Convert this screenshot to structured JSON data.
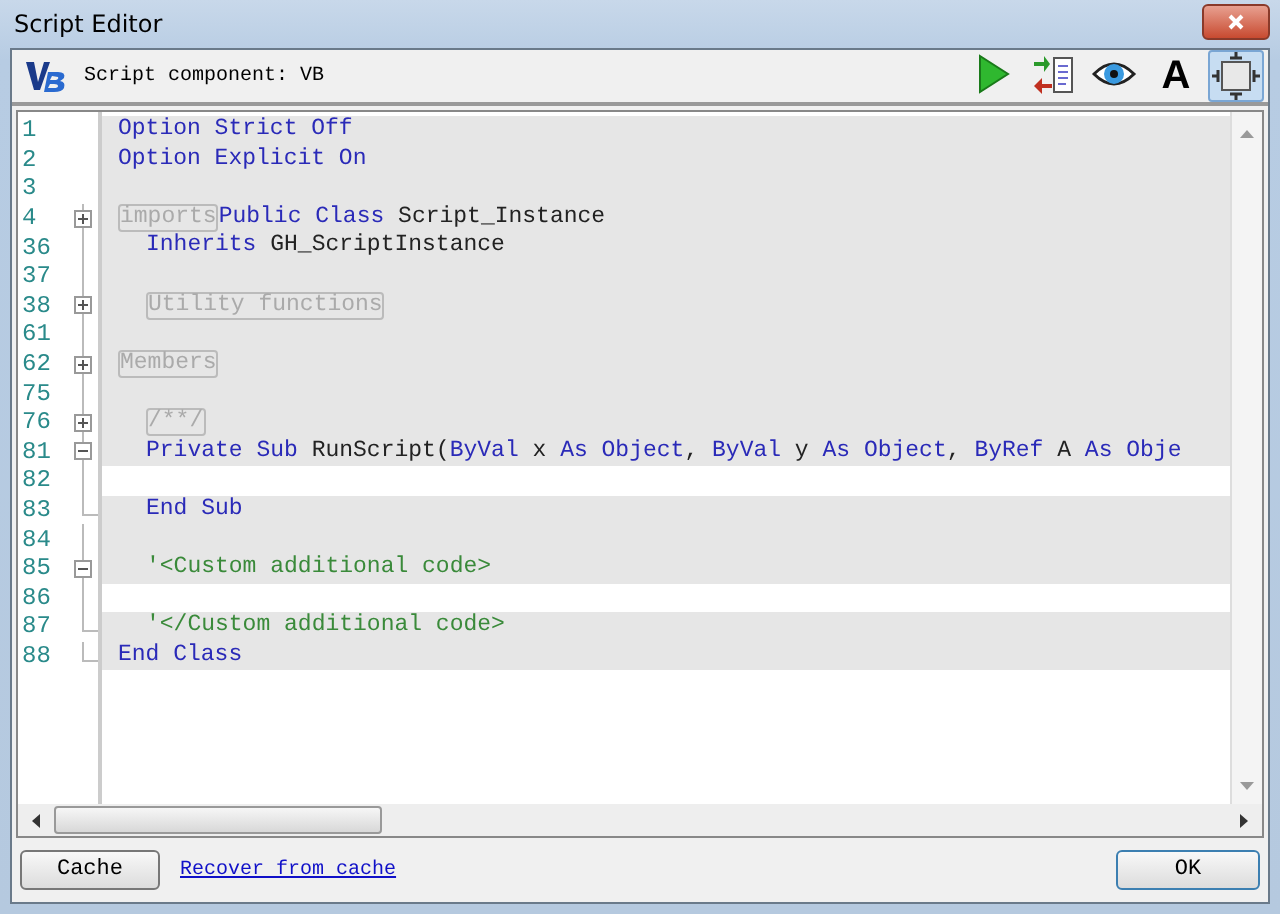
{
  "window": {
    "title": "Script Editor"
  },
  "toolbar": {
    "component_label": "Script component: VB",
    "buttons": [
      {
        "kind": "run",
        "selected": false
      },
      {
        "kind": "transfer",
        "selected": false
      },
      {
        "kind": "eye",
        "selected": false
      },
      {
        "kind": "font",
        "label": "A",
        "selected": false
      },
      {
        "kind": "window",
        "selected": true
      }
    ]
  },
  "editor": {
    "lines": [
      {
        "number": "1",
        "kind": "plain",
        "indented": false,
        "shaded": true,
        "tokens": [
          {
            "kind": "keyword",
            "text": "Option Strict Off"
          }
        ]
      },
      {
        "number": "2",
        "kind": "plain",
        "indented": false,
        "shaded": true,
        "tokens": [
          {
            "kind": "keyword",
            "text": "Option Explicit On"
          }
        ]
      },
      {
        "number": "3",
        "kind": "plain",
        "shaded": true
      },
      {
        "number": "4",
        "kind": "collapsed",
        "indented": false,
        "shaded": true,
        "tokens": [
          {
            "kind": "region",
            "text": "imports"
          },
          {
            "kind": "keyword",
            "text": "Public Class"
          },
          {
            "kind": "plain",
            "text": " Script_Instance"
          }
        ]
      },
      {
        "number": "36",
        "kind": "inside",
        "indented": true,
        "shaded": true,
        "tokens": [
          {
            "kind": "keyword",
            "text": "Inherits"
          },
          {
            "kind": "plain",
            "text": " GH_ScriptInstance"
          }
        ]
      },
      {
        "number": "37",
        "kind": "inside",
        "shaded": true
      },
      {
        "number": "38",
        "kind": "collapsed",
        "indented": true,
        "shaded": true,
        "tokens": [
          {
            "kind": "region",
            "text": "Utility functions"
          }
        ]
      },
      {
        "number": "61",
        "kind": "inside",
        "shaded": true
      },
      {
        "number": "62",
        "kind": "collapsed",
        "indented": false,
        "shaded": true,
        "tokens": [
          {
            "kind": "region",
            "text": "Members"
          }
        ]
      },
      {
        "number": "75",
        "kind": "inside",
        "shaded": true
      },
      {
        "number": "76",
        "kind": "collapsed",
        "indented": true,
        "shaded": true,
        "tokens": [
          {
            "kind": "region",
            "text": "/**/"
          }
        ]
      },
      {
        "number": "81",
        "kind": "expanded",
        "indented": true,
        "shaded": true,
        "tokens": [
          {
            "kind": "keyword",
            "text": "Private Sub"
          },
          {
            "kind": "plain",
            "text": " RunScript("
          },
          {
            "kind": "keyword",
            "text": "ByVal"
          },
          {
            "kind": "plain",
            "text": " x "
          },
          {
            "kind": "keyword",
            "text": "As Object"
          },
          {
            "kind": "plain",
            "text": ", "
          },
          {
            "kind": "keyword",
            "text": "ByVal"
          },
          {
            "kind": "plain",
            "text": " y "
          },
          {
            "kind": "keyword",
            "text": "As Object"
          },
          {
            "kind": "plain",
            "text": ", "
          },
          {
            "kind": "keyword",
            "text": "ByRef"
          },
          {
            "kind": "plain",
            "text": " A "
          },
          {
            "kind": "keyword",
            "text": "As Obje"
          }
        ]
      },
      {
        "number": "82",
        "kind": "inside"
      },
      {
        "number": "83",
        "kind": "block_end",
        "indented": true,
        "shaded": true,
        "tokens": [
          {
            "kind": "keyword",
            "text": "End Sub"
          }
        ]
      },
      {
        "number": "84",
        "kind": "inside",
        "shaded": true
      },
      {
        "number": "85",
        "kind": "expanded",
        "indented": true,
        "shaded": true,
        "tokens": [
          {
            "kind": "comment",
            "text": "'<Custom additional code>"
          }
        ]
      },
      {
        "number": "86",
        "kind": "inside"
      },
      {
        "number": "87",
        "kind": "block_end",
        "indented": true,
        "shaded": true,
        "tokens": [
          {
            "kind": "comment",
            "text": "'</Custom additional code>"
          }
        ]
      },
      {
        "number": "88",
        "kind": "block_end",
        "indented": false,
        "shaded": true,
        "tokens": [
          {
            "kind": "keyword",
            "text": "End Class"
          }
        ]
      }
    ]
  },
  "footer": {
    "cache_button": "Cache",
    "recover_link": "Recover from cache",
    "ok_button": "OK"
  }
}
